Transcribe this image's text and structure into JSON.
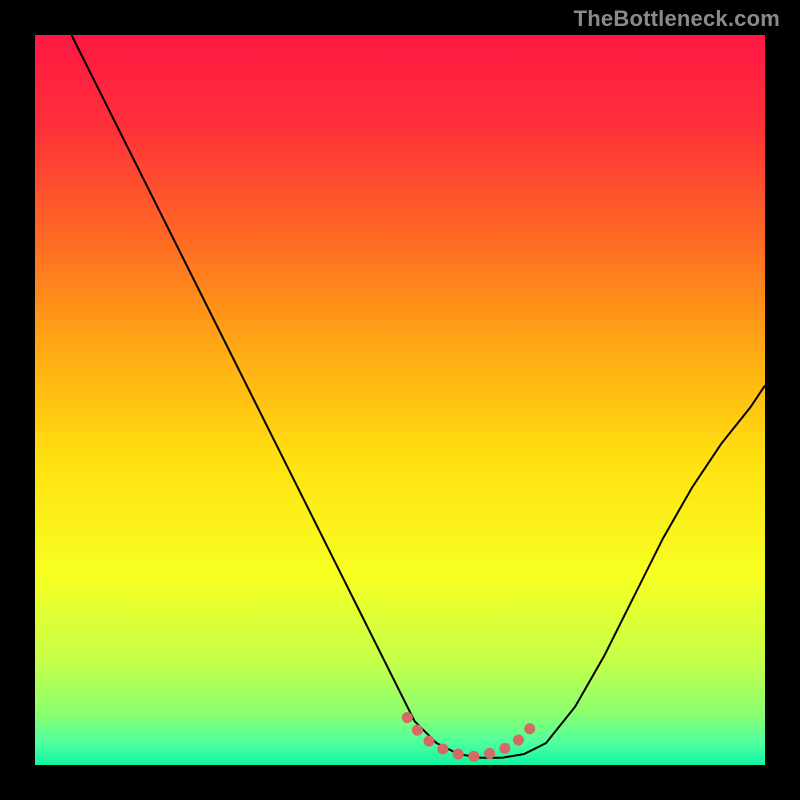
{
  "watermark": "TheBottleneck.com",
  "chart_data": {
    "type": "line",
    "title": "",
    "xlabel": "",
    "ylabel": "",
    "xlim": [
      0,
      100
    ],
    "ylim": [
      0,
      100
    ],
    "background_gradient_stops": [
      {
        "offset": 0.0,
        "color": "#ff1843"
      },
      {
        "offset": 0.12,
        "color": "#ff2f3a"
      },
      {
        "offset": 0.28,
        "color": "#ff6a24"
      },
      {
        "offset": 0.42,
        "color": "#ffa514"
      },
      {
        "offset": 0.58,
        "color": "#ffe010"
      },
      {
        "offset": 0.74,
        "color": "#f7ff22"
      },
      {
        "offset": 0.86,
        "color": "#c4ff4a"
      },
      {
        "offset": 0.93,
        "color": "#8aff70"
      },
      {
        "offset": 0.97,
        "color": "#4dffa0"
      },
      {
        "offset": 1.0,
        "color": "#11f5a1"
      }
    ],
    "series": [
      {
        "name": "bottleneck-curve",
        "stroke": "#000000",
        "stroke_width": 2,
        "x": [
          5,
          9,
          13,
          17,
          21,
          25,
          29,
          33,
          37,
          41,
          45,
          49,
          52,
          55,
          58,
          61,
          64,
          67,
          70,
          74,
          78,
          82,
          86,
          90,
          94,
          98,
          100
        ],
        "y": [
          100,
          92,
          84,
          76,
          68,
          60,
          52,
          44,
          36,
          28,
          20,
          12,
          6,
          3,
          1.5,
          1,
          1,
          1.5,
          3,
          8,
          15,
          23,
          31,
          38,
          44,
          49,
          52
        ]
      },
      {
        "name": "optimal-band",
        "stroke": "#d46a63",
        "stroke_width": 11,
        "dash": "0.1 16",
        "linecap": "round",
        "x": [
          51,
          53,
          55,
          57,
          59,
          61,
          63,
          65,
          67,
          69
        ],
        "y": [
          6.5,
          4,
          2.5,
          1.8,
          1.2,
          1.2,
          1.8,
          2.5,
          4,
          6.5
        ]
      }
    ]
  }
}
